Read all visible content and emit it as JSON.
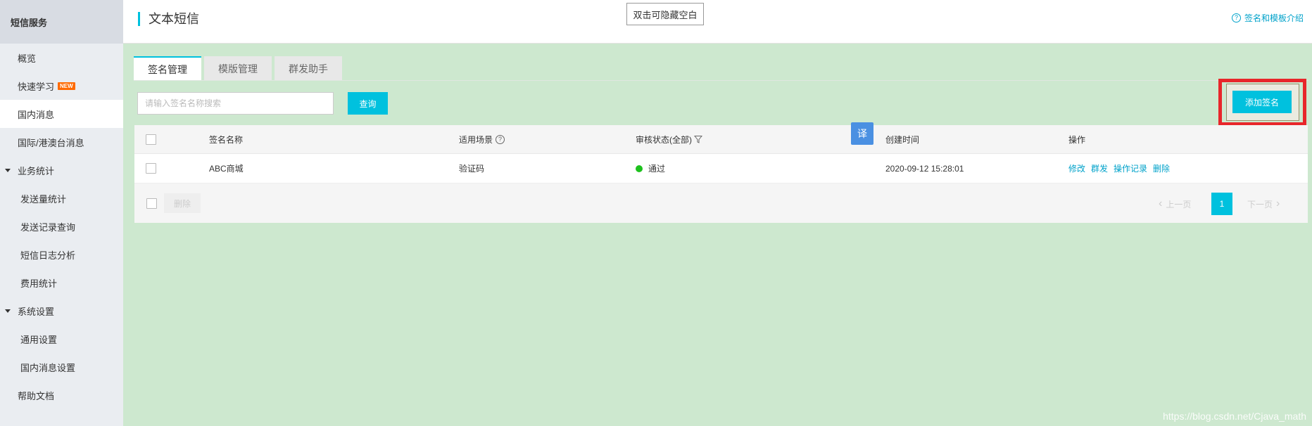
{
  "sidebar": {
    "header": "短信服务",
    "items": [
      {
        "label": "概览"
      },
      {
        "label": "快速学习",
        "badge": "NEW"
      },
      {
        "label": "国内消息"
      },
      {
        "label": "国际/港澳台消息"
      }
    ],
    "group_business": "业务统计",
    "business_items": [
      "发送量统计",
      "发送记录查询",
      "短信日志分析",
      "费用统计"
    ],
    "group_settings": "系统设置",
    "settings_items": [
      "通用设置",
      "国内消息设置"
    ],
    "help_docs": "帮助文档"
  },
  "header": {
    "title": "文本短信",
    "hide_blank_button": "双击可隐藏空白",
    "help_link": "签名和模板介绍"
  },
  "tabs": [
    {
      "label": "签名管理"
    },
    {
      "label": "模版管理"
    },
    {
      "label": "群发助手"
    }
  ],
  "search": {
    "placeholder": "请输入签名名称搜索",
    "query_label": "查询"
  },
  "add_signature_label": "添加签名",
  "translate_label": "译",
  "table": {
    "columns": {
      "name": "签名名称",
      "scene": "适用场景",
      "status": "审核状态(全部)",
      "created": "创建时间",
      "actions": "操作"
    },
    "rows": [
      {
        "name": "ABC商城",
        "scene": "验证码",
        "status": "通过",
        "created": "2020-09-12 15:28:01",
        "actions": [
          "修改",
          "群发",
          "操作记录",
          "删除"
        ]
      }
    ],
    "footer": {
      "delete_label": "删除",
      "prev_label": "上一页",
      "page": "1",
      "next_label": "下一页"
    }
  },
  "watermark": "https://blog.csdn.net/Cjava_math",
  "colors": {
    "accent": "#00c1de",
    "link": "#00a2ca",
    "highlight": "#e8262b",
    "background": "#cde8cf",
    "status_ok": "#1dc11d"
  }
}
